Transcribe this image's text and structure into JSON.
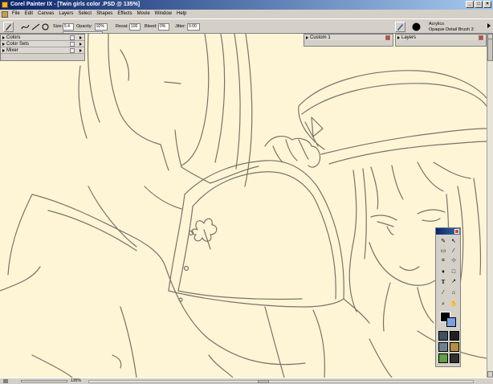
{
  "window": {
    "title": "Corel Painter IX - [Twin girls  color  .PSD @ 135%]"
  },
  "menu": [
    "File",
    "Edit",
    "Canvas",
    "Layers",
    "Select",
    "Shapes",
    "Effects",
    "Movie",
    "Window",
    "Help"
  ],
  "property_bar": {
    "size_label": "Size:",
    "size_value": "5.4",
    "opacity_label": "Opacity:",
    "opacity_value": "92%",
    "resat_label": "Resat:",
    "resat_value": "100",
    "bleed_label": "Bleed:",
    "bleed_value": "0%",
    "jitter_label": "Jitter:",
    "jitter_value": "0.00"
  },
  "brush_selector": {
    "category": "Acrylics",
    "variant": "Opaque Detail Brush 3"
  },
  "panels": {
    "left": [
      "Colors",
      "Color Sets",
      "Mixer"
    ],
    "custom": "Custom 1",
    "layers": "Layers"
  },
  "status": {
    "zoom": "135%"
  },
  "colors": {
    "canvas": "#fef5d6",
    "line": "#7a7268",
    "titlebar": "#0a246a"
  }
}
